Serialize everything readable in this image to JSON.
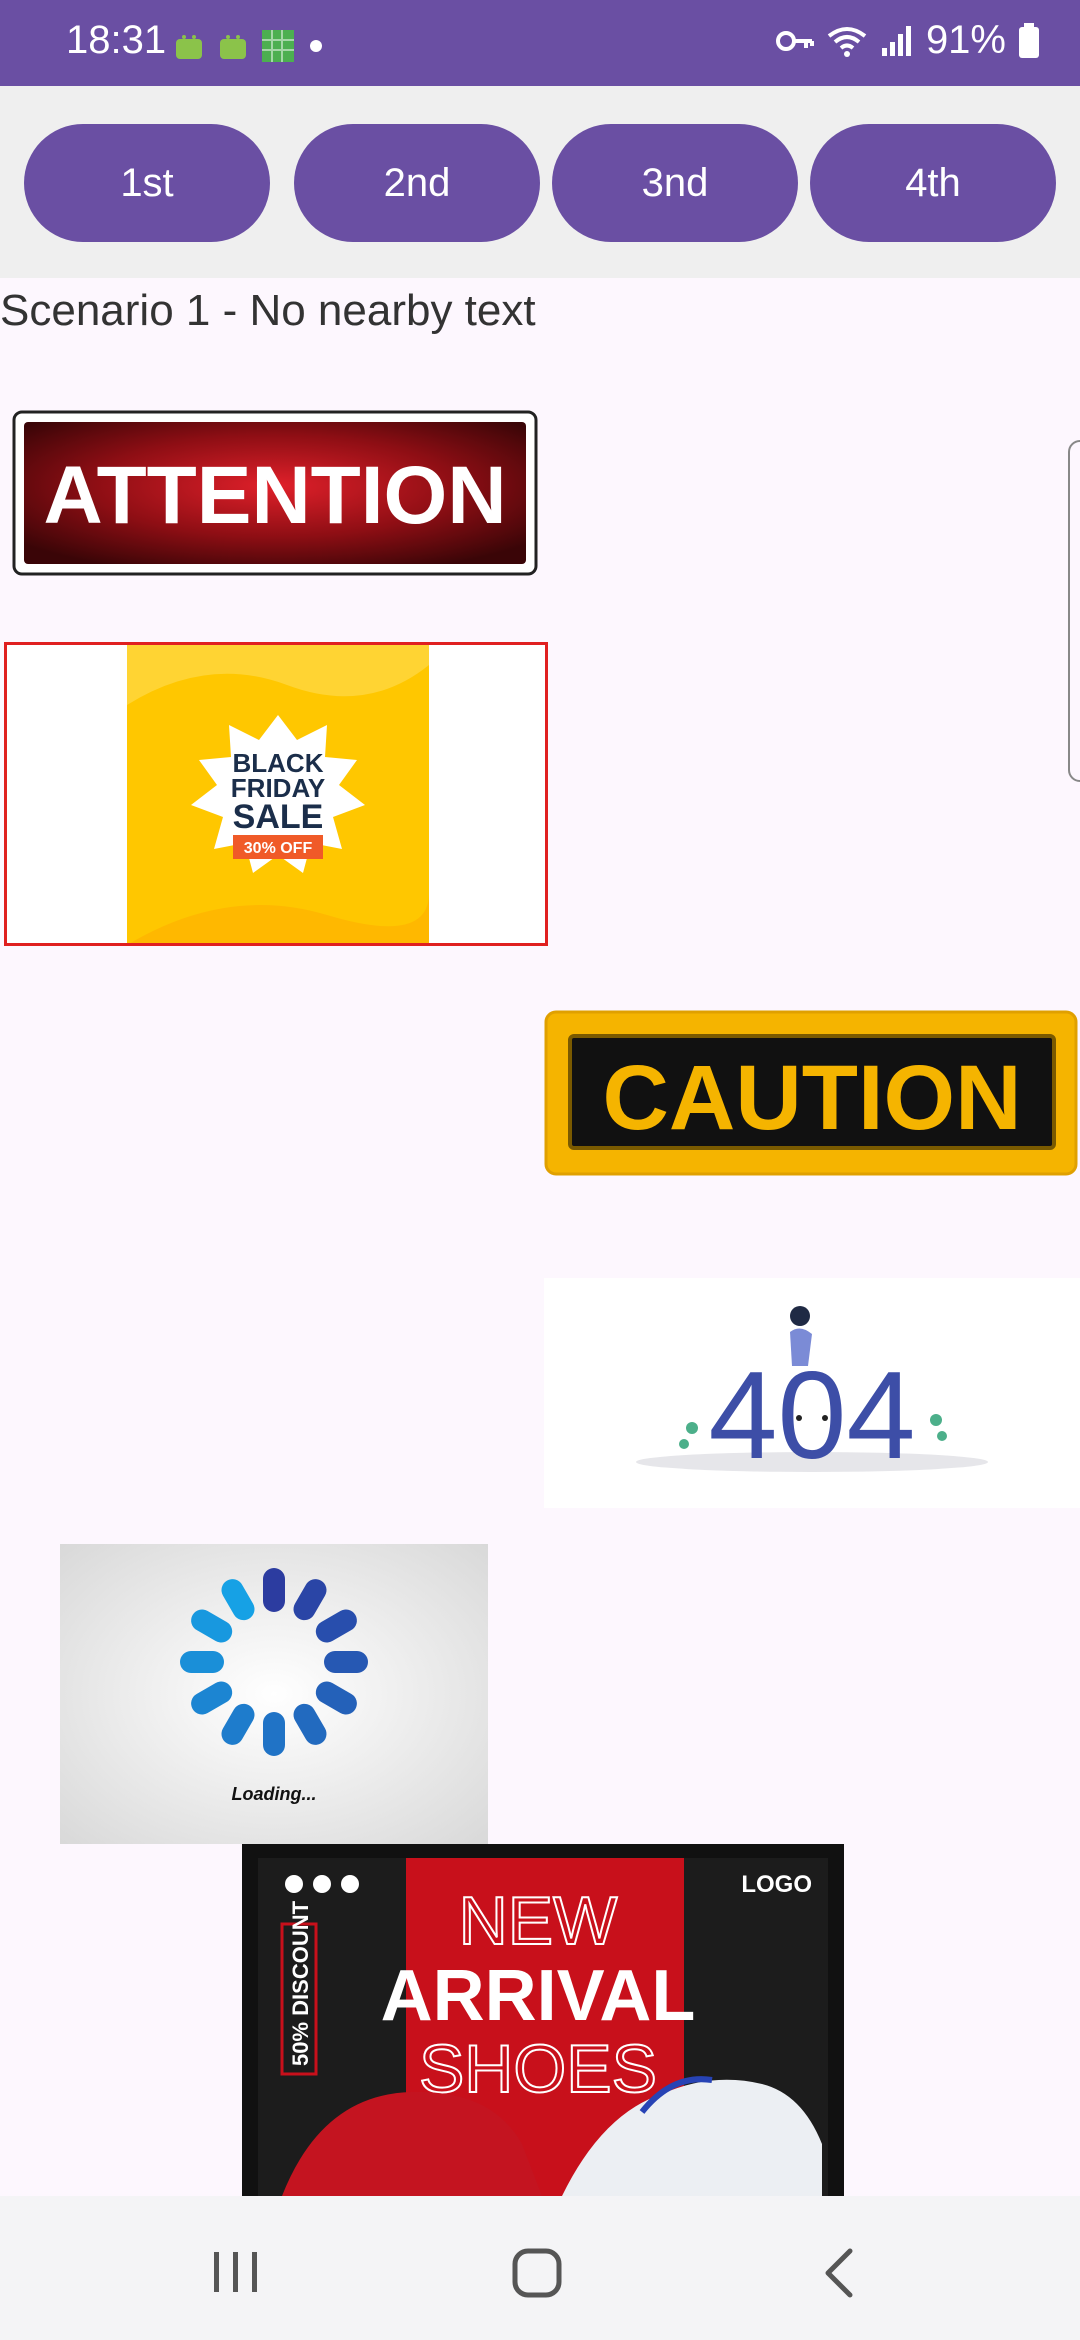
{
  "status": {
    "time": "18:31",
    "battery": "91%"
  },
  "tabs": [
    {
      "label": "1st"
    },
    {
      "label": "2nd"
    },
    {
      "label": "3nd"
    },
    {
      "label": "4th"
    }
  ],
  "scenario_label": "Scenario 1 - No nearby text",
  "images": {
    "attention": {
      "text": "ATTENTION"
    },
    "blackfriday": {
      "line1": "BLACK",
      "line2": "FRIDAY",
      "line3": "SALE",
      "badge": "30% OFF"
    },
    "caution": {
      "text": "CAUTION"
    },
    "error404": {
      "text": "404"
    },
    "loading": {
      "text": "Loading..."
    },
    "shoes": {
      "logo": "LOGO",
      "discount": "50% DISCOUNT",
      "line1": "NEW",
      "line2": "ARRIVAL",
      "line3": "SHOES"
    }
  },
  "colors": {
    "primary": "#6A4FA3",
    "background": "#FDF7FE"
  }
}
